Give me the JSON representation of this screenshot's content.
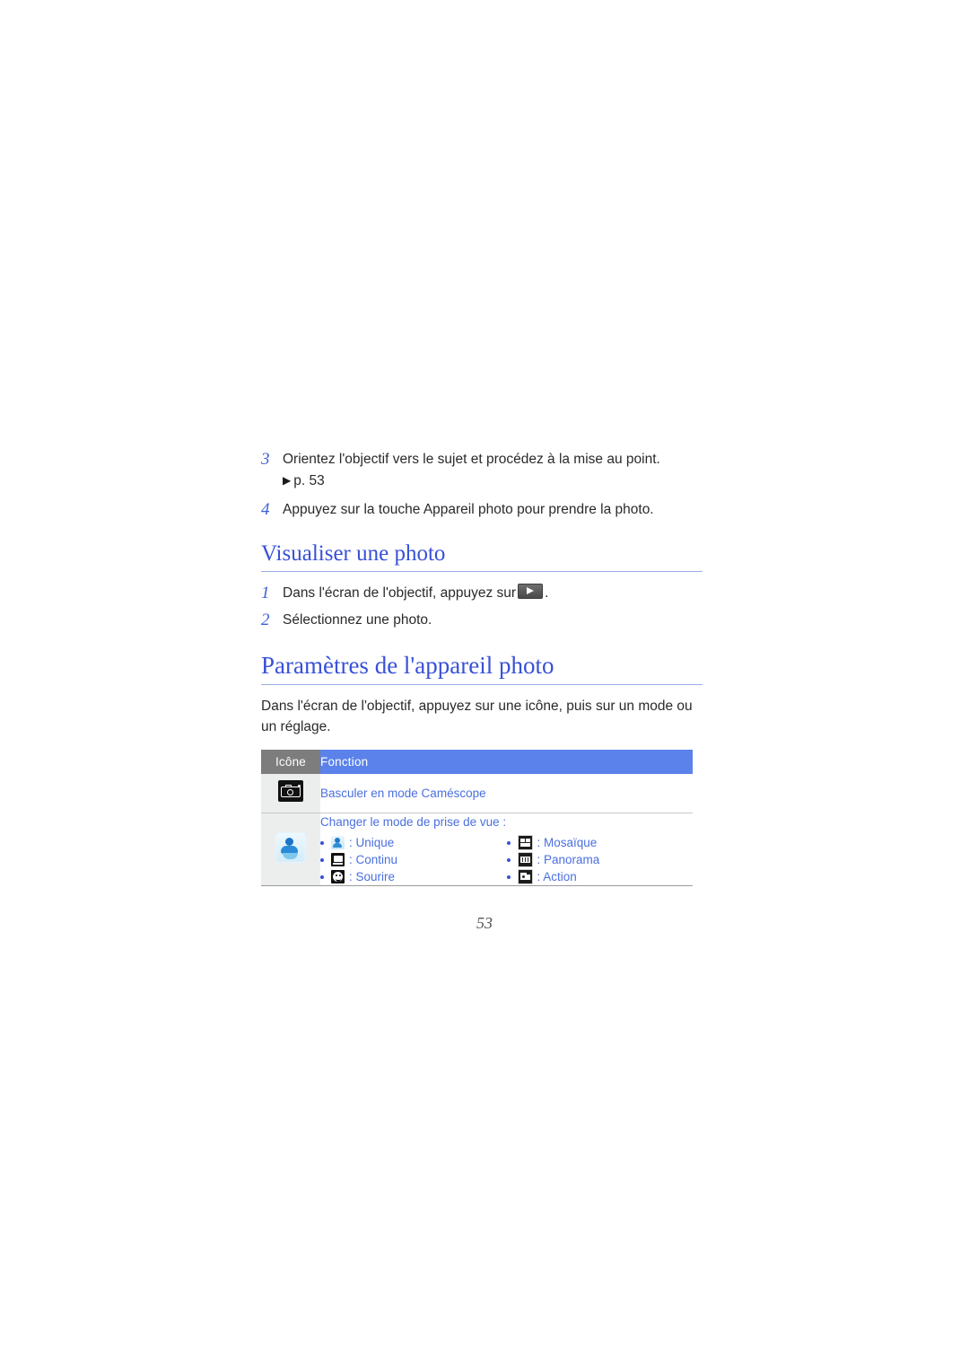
{
  "page": {
    "number": "53"
  },
  "steps_top": [
    {
      "num": "3",
      "text": "Orientez l'objectif vers le sujet et procédez à la mise au point.",
      "ref": "p. 53"
    },
    {
      "num": "4",
      "text": "Appuyez sur la touche Appareil photo pour prendre la photo.",
      "ref": ""
    }
  ],
  "section_view": {
    "title": "Visualiser une photo",
    "steps": [
      {
        "num": "1",
        "text_before": "Dans l'écran de l'objectif, appuyez sur",
        "icon": "play-icon",
        "text_after": "."
      },
      {
        "num": "2",
        "text_before": "Sélectionnez une photo.",
        "icon": "",
        "text_after": ""
      }
    ]
  },
  "section_settings": {
    "title": "Paramètres de l'appareil photo",
    "intro": "Dans l'écran de l'objectif, appuyez sur une icône, puis sur un mode ou un réglage.",
    "table": {
      "headers": {
        "icon": "Icône",
        "function": "Fonction"
      },
      "rows": [
        {
          "icon_name": "camera-switch-icon",
          "function": "Basculer en mode Caméscope"
        },
        {
          "icon_name": "shooting-mode-icon",
          "function": "Changer le mode de prise de vue :",
          "modes_left": [
            {
              "icon_name": "single-shot-icon",
              "label": ": Unique"
            },
            {
              "icon_name": "continuous-shot-icon",
              "label": ": Continu"
            },
            {
              "icon_name": "smile-shot-icon",
              "label": ": Sourire"
            }
          ],
          "modes_right": [
            {
              "icon_name": "mosaic-shot-icon",
              "label": ": Mosaïque"
            },
            {
              "icon_name": "panorama-shot-icon",
              "label": ": Panorama"
            },
            {
              "icon_name": "action-shot-icon",
              "label": ": Action"
            }
          ]
        }
      ]
    }
  },
  "colors": {
    "heading_blue": "#3850d8",
    "link_blue": "#4a6fe0",
    "header_gray": "#7d7d7d",
    "header_blue": "#5b82ea",
    "icon_cell_gray": "#eceded"
  }
}
